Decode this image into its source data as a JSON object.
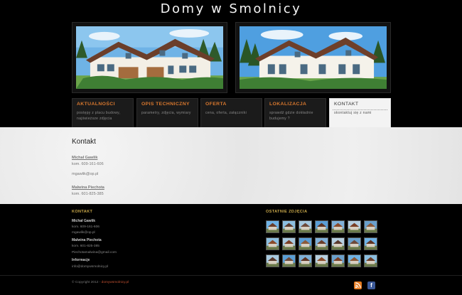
{
  "site": {
    "title": "Domy w Smolnicy"
  },
  "gallery_top": [
    {
      "alt": "house-front-left"
    },
    {
      "alt": "house-front-right"
    }
  ],
  "nav": [
    {
      "title": "AKTUALNOŚCI",
      "desc": "postępy z placu budowy, najświeższe zdjęcia"
    },
    {
      "title": "OPIS TECHNICZNY",
      "desc": "parametry, zdjęcia, wymiary"
    },
    {
      "title": "OFERTA",
      "desc": "cena, oferta, załączniki"
    },
    {
      "title": "LOKALIZACJA",
      "desc": "sprawdź gdzie dokładnie budujemy ?"
    },
    {
      "title": "KONTAKT",
      "desc": "skontaktuj się z nami",
      "active": true
    }
  ],
  "main": {
    "heading": "Kontakt",
    "person1": {
      "name": "Michał Gawlik",
      "phone": "kom. 609-161-606",
      "email": "mgawlik@op.pl"
    },
    "person2": {
      "name": "Malwina Piechota",
      "phone": "kom. 601-825-385"
    }
  },
  "footer": {
    "contact_heading": "KONTAKT",
    "contact_lines": [
      {
        "text": "Michał Gawlik",
        "bold": true
      },
      {
        "text": "kom. 609-161-606"
      },
      {
        "text": "mgawlik@op.pl"
      },
      {
        "text": "Malwina Piechota",
        "bold": true
      },
      {
        "text": "kom. 601-825-385"
      },
      {
        "text": "Piechotamalwina@gmail.com"
      },
      {
        "text": "Informacje",
        "bold": true
      },
      {
        "text": "info@domywsmolnicy.pl"
      }
    ],
    "photos_heading": "OSTATNIE ZDJĘCIA",
    "copyright_prefix": "© Copyright 2012 - ",
    "copyright_link": "domywsmolnicy.pl",
    "icons": [
      "rss-icon",
      "facebook-icon"
    ]
  },
  "colors": {
    "accent": "#d9782e",
    "footer_heading": "#c9a84a",
    "link": "#c05030"
  }
}
